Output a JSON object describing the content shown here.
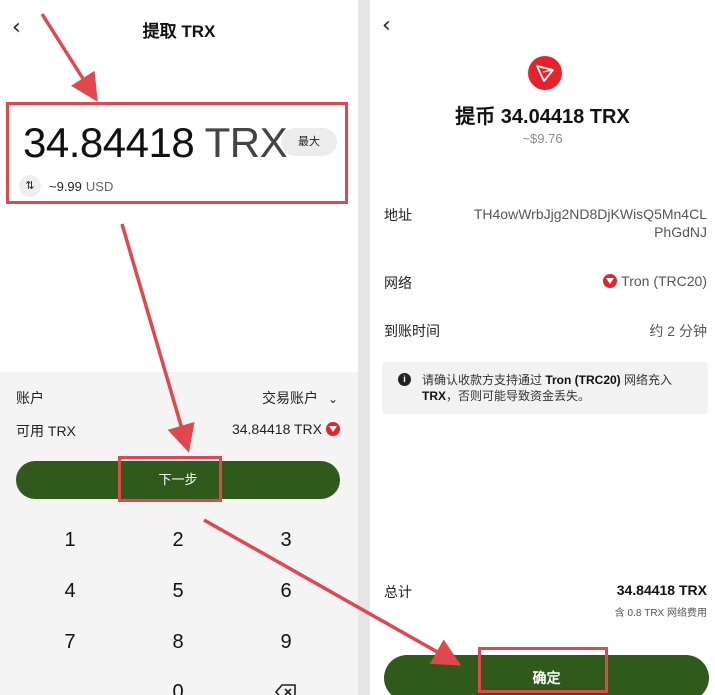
{
  "left": {
    "title": "提取 TRX",
    "amount": "34.84418",
    "amount_unit": "TRX",
    "max_label": "最大",
    "usd_value": "~9.99",
    "usd_unit": "USD",
    "account_label": "账户",
    "account_value": "交易账户",
    "available_label": "可用 TRX",
    "available_value": "34.84418 TRX",
    "next_label": "下一步",
    "keypad": [
      "1",
      "2",
      "3",
      "4",
      "5",
      "6",
      "7",
      "8",
      "9",
      "0"
    ]
  },
  "right": {
    "title": "提币 34.04418 TRX",
    "subtitle": "~$9.76",
    "address_label": "地址",
    "address_value": "TH4owWrbJjg2ND8DjKWisQ5Mn4CLPhGdNJ",
    "network_label": "网络",
    "network_value": "Tron (TRC20)",
    "arrival_label": "到账时间",
    "arrival_value": "约 2 分钟",
    "notice_prefix": "请确认收款方支持通过 ",
    "notice_network": "Tron (TRC20)",
    "notice_middle": " 网络充入 ",
    "notice_asset": "TRX",
    "notice_suffix": "，否则可能导致资金丢失。",
    "total_label": "总计",
    "total_value": "34.84418 TRX",
    "total_sub": "含 0.8 TRX 网络费用",
    "confirm_label": "确定"
  },
  "colors": {
    "accent_green": "#2f5a1c",
    "annotation_red": "#e0484e",
    "tron_red": "#e8222a"
  }
}
